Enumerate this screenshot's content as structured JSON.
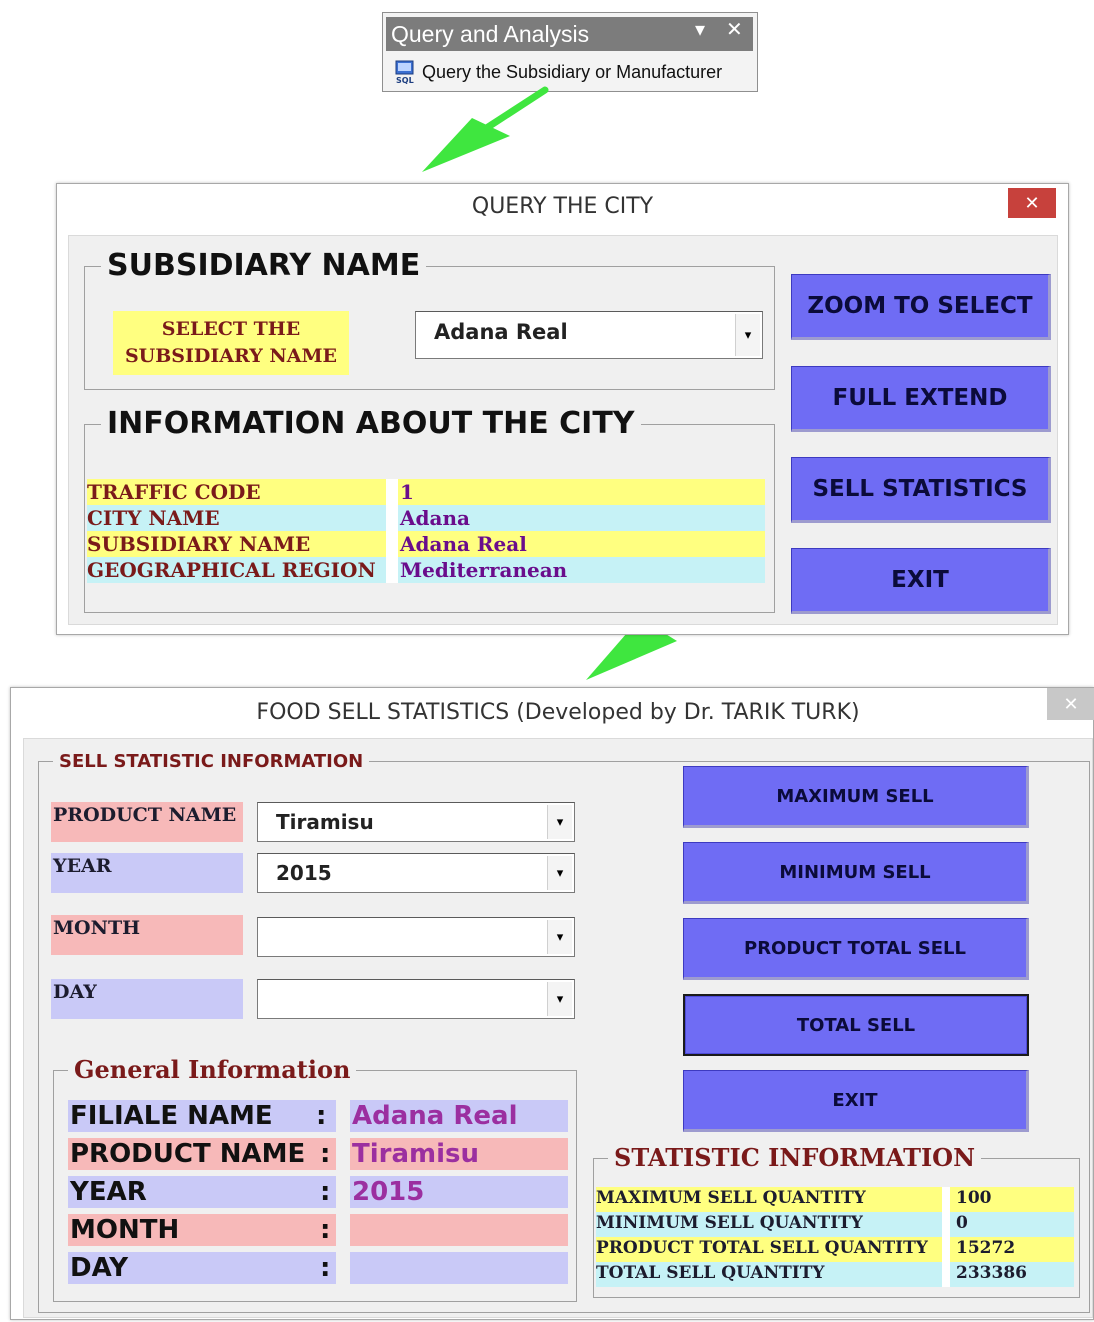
{
  "query_panel": {
    "title": "Query and Analysis",
    "dropdown_glyph": "▾",
    "close_glyph": "✕",
    "menu_item": "Query the Subsidiary or Manufacturer",
    "icon": "sql-icon"
  },
  "arrow_color": "#3fe63f",
  "city_window": {
    "title": "QUERY THE CITY",
    "close_glyph": "✕",
    "subsidiary_group": {
      "legend": "SUBSIDIARY NAME",
      "select_label": "SELECT THE SUBSIDIARY NAME",
      "selected_value": "Adana Real"
    },
    "info_group": {
      "legend": "INFORMATION ABOUT THE CITY",
      "rows": [
        {
          "label": "TRAFFIC CODE",
          "value": "1"
        },
        {
          "label": "CITY NAME",
          "value": "Adana"
        },
        {
          "label": "SUBSIDIARY NAME",
          "value": "Adana Real"
        },
        {
          "label": "GEOGRAPHICAL REGION",
          "value": "Mediterranean"
        }
      ]
    },
    "buttons": {
      "zoom": "ZOOM TO SELECT",
      "full_extend": "FULL EXTEND",
      "sell_statistics": "SELL STATISTICS",
      "exit": "EXIT"
    }
  },
  "stats_window": {
    "title": "FOOD SELL STATISTICS (Developed by Dr. TARIK TURK)",
    "close_glyph": "✕",
    "sell_group": {
      "legend": "SELL STATISTIC INFORMATION",
      "product_label": "PRODUCT NAME",
      "product_value": "Tiramisu",
      "year_label": "YEAR",
      "year_value": "2015",
      "month_label": "MONTH",
      "month_value": "",
      "day_label": "DAY",
      "day_value": ""
    },
    "general_group": {
      "legend": "General Information",
      "rows": [
        {
          "label": "FILIALE NAME",
          "colon": ":",
          "value": "Adana Real"
        },
        {
          "label": "PRODUCT NAME",
          "colon": ":",
          "value": "Tiramisu"
        },
        {
          "label": "YEAR",
          "colon": ":",
          "value": "2015"
        },
        {
          "label": "MONTH",
          "colon": ":",
          "value": ""
        },
        {
          "label": "DAY",
          "colon": ":",
          "value": ""
        }
      ]
    },
    "buttons": {
      "maximum": "MAXIMUM SELL",
      "minimum": "MINIMUM SELL",
      "product_total": "PRODUCT TOTAL SELL",
      "total": "TOTAL SELL",
      "exit": "EXIT"
    },
    "statistic_group": {
      "legend": "STATISTIC INFORMATION",
      "rows": [
        {
          "label": "MAXIMUM SELL QUANTITY",
          "value": "100"
        },
        {
          "label": "MINIMUM SELL QUANTITY",
          "value": "0"
        },
        {
          "label": "PRODUCT TOTAL SELL QUANTITY",
          "value": "15272"
        },
        {
          "label": "TOTAL SELL QUANTITY",
          "value": "233386"
        }
      ]
    }
  },
  "combo_arrow": "▾",
  "colors": {
    "button": "#6f6cf4",
    "yellow_row": "#ffff80",
    "cyan_row": "#c6f2f6",
    "pink_label": "#f7b9b9",
    "lavender_label": "#c9c9f7"
  }
}
